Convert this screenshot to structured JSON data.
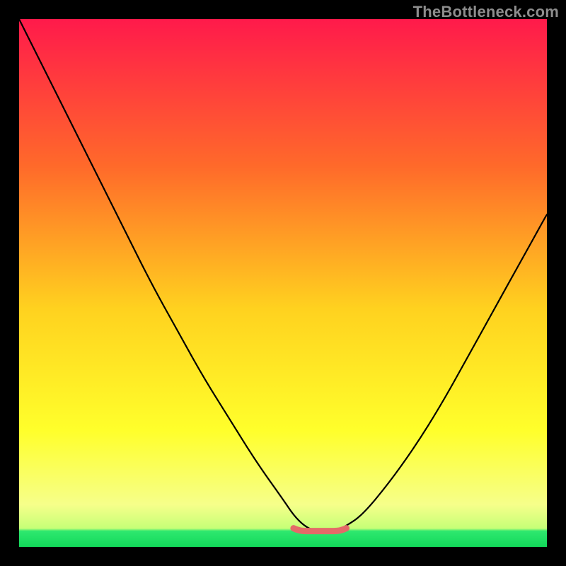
{
  "watermark": "TheBottleneck.com",
  "colors": {
    "frame": "#000000",
    "curve": "#000000",
    "marker": "#e46a68",
    "green_band": "#2ee86f",
    "gradient_top": "#ff1a4b",
    "gradient_mid1": "#ff6a2a",
    "gradient_mid2": "#ffd21f",
    "gradient_mid3": "#ffff2b",
    "gradient_low": "#f6ff8a"
  },
  "chart_data": {
    "type": "line",
    "title": "",
    "xlabel": "",
    "ylabel": "",
    "xlim": [
      0,
      100
    ],
    "ylim": [
      0,
      100
    ],
    "grid": false,
    "legend": false,
    "series": [
      {
        "name": "bottleneck-curve",
        "x": [
          0,
          5,
          10,
          15,
          20,
          25,
          30,
          35,
          40,
          45,
          50,
          52,
          54,
          56,
          58,
          60,
          62,
          65,
          70,
          75,
          80,
          85,
          90,
          95,
          100
        ],
        "y": [
          100,
          90,
          80,
          70,
          60,
          50,
          41,
          32,
          24,
          16,
          9,
          6,
          4,
          3,
          3,
          3,
          4,
          6,
          12,
          19,
          27,
          36,
          45,
          54,
          63
        ]
      }
    ],
    "flat_region": {
      "x_start": 52,
      "x_end": 62,
      "y": 3
    },
    "green_band": {
      "y_top": 3,
      "y_bottom": 0
    },
    "annotations": [
      {
        "text": "TheBottleneck.com",
        "position": "top-right"
      }
    ]
  }
}
